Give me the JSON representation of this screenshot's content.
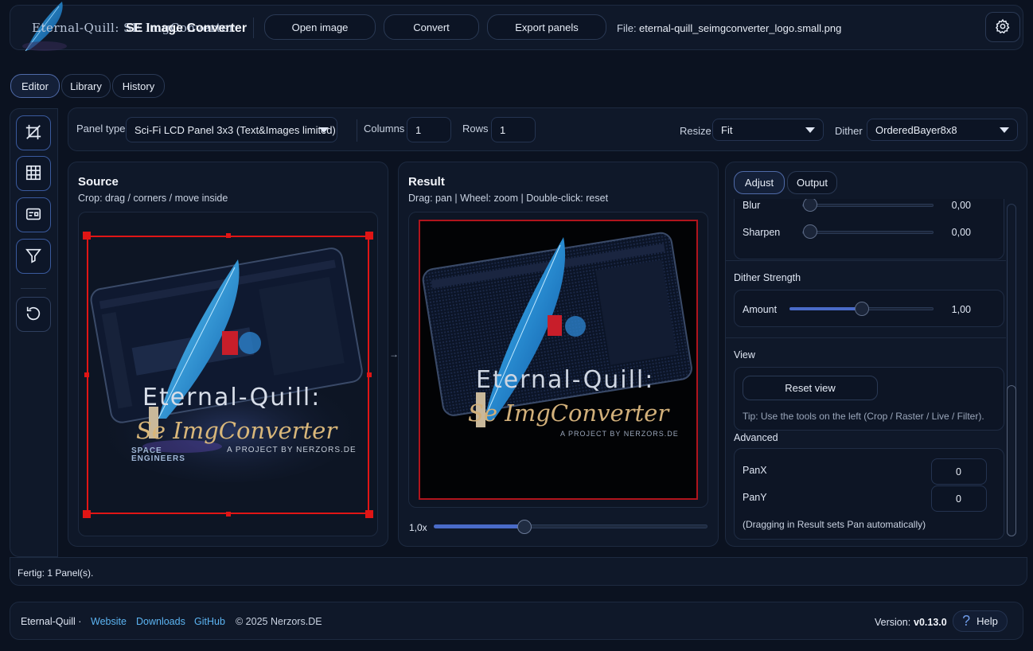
{
  "header": {
    "app_title": "SE Image Converter",
    "logo_text": "Eternal-Quill: SE ImgConverter",
    "open_label": "Open image",
    "convert_label": "Convert",
    "export_label": "Export panels",
    "file_label": "File:",
    "file_name": "eternal-quill_seimgconverter_logo.small.png",
    "settings_icon": "gear-icon"
  },
  "tabs": [
    {
      "label": "Editor",
      "active": true
    },
    {
      "label": "Library",
      "active": false
    },
    {
      "label": "History",
      "active": false
    }
  ],
  "tools": [
    "crop-icon",
    "grid-icon",
    "live-icon",
    "filter-icon",
    "reset-icon"
  ],
  "options": {
    "panel_type_label": "Panel type",
    "panel_type_value": "Sci-Fi LCD Panel 3x3 (Text&Images limited)",
    "columns_label": "Columns",
    "columns_value": "1",
    "rows_label": "Rows",
    "rows_value": "1",
    "resize_label": "Resize",
    "resize_value": "Fit",
    "dither_label": "Dither",
    "dither_value": "OrderedBayer8x8"
  },
  "source": {
    "title": "Source",
    "hint": "Crop: drag / corners / move inside",
    "image_text_1": "Eternal-Quill:",
    "image_text_2": "Se ImgConverter",
    "image_text_3": "A PROJECT BY NERZORS.DE",
    "image_text_4": "SPACE ENGINEERS"
  },
  "arrow": "→",
  "result": {
    "title": "Result",
    "hint": "Drag: pan | Wheel: zoom | Double-click: reset",
    "zoom_label": "1,0x",
    "zoom_fraction": 0.33,
    "image_text_1": "Eternal-Quill:",
    "image_text_2": "Se ImgConverter",
    "image_text_3": "A PROJECT BY NERZORS.DE"
  },
  "right": {
    "tab_adjust": "Adjust",
    "tab_output": "Output",
    "blur_label": "Blur",
    "blur_value": "0,00",
    "sharpen_label": "Sharpen",
    "sharpen_value": "0,00",
    "dither_strength_title": "Dither Strength",
    "amount_label": "Amount",
    "amount_value": "1,00",
    "amount_fraction": 0.5,
    "view_title": "View",
    "reset_view_label": "Reset view",
    "tip": "Tip: Use the tools on the left (Crop / Raster / Live / Filter).",
    "advanced_title": "Advanced",
    "panx_label": "PanX",
    "panx_value": "0",
    "pany_label": "PanY",
    "pany_value": "0",
    "pan_note": "(Dragging in Result sets Pan automatically)"
  },
  "status": "Fertig: 1 Panel(s).",
  "footer": {
    "brand": "Eternal-Quill ·",
    "website": "Website",
    "downloads": "Downloads",
    "github": "GitHub",
    "copyright": "© 2025 Nerzors.DE",
    "version_label": "Version:",
    "version_value": "v0.13.0",
    "help_label": "Help"
  },
  "colors": {
    "background": "#0b1220",
    "accent": "#4a6bc8",
    "crop": "#e01515",
    "link": "#5cb4f2"
  }
}
